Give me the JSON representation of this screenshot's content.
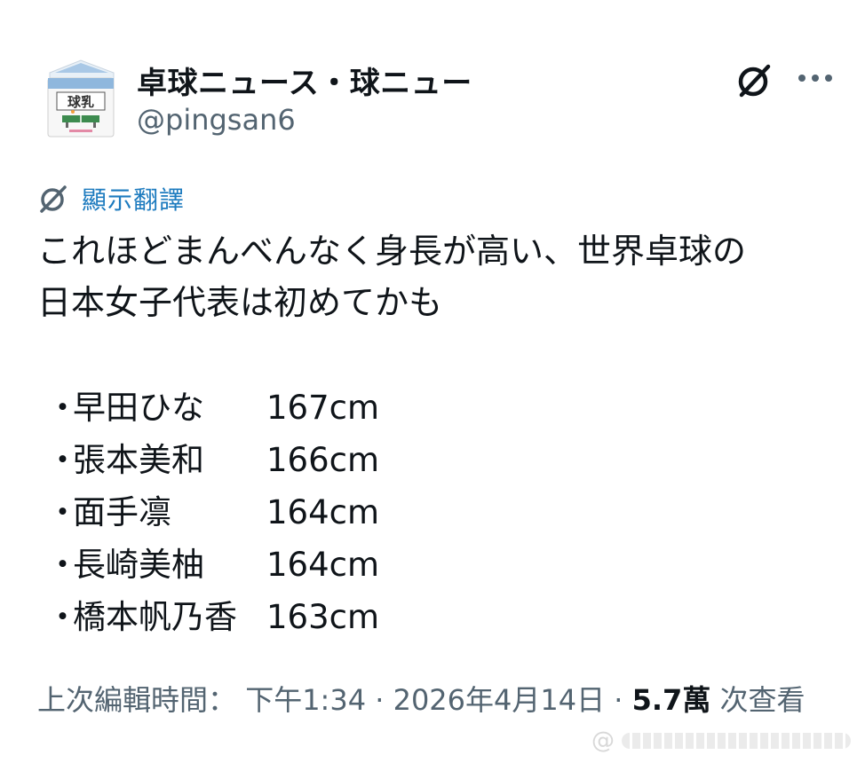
{
  "author": {
    "display_name": "卓球ニュース・球ニュー",
    "handle": "@pingsan6",
    "avatar_icon": "milk-carton-avatar-icon",
    "avatar_text": "球乳"
  },
  "toolbar": {
    "grok_icon": "grok-icon",
    "more_icon": "more-horizontal-icon"
  },
  "translate": {
    "icon": "grok-translate-icon",
    "label": "顯示翻譯"
  },
  "post": {
    "lines": [
      "これほどまんべんなく身長が高い、世界卓球の",
      "日本女子代表は初めてかも"
    ],
    "list": [
      {
        "bullet": "・",
        "name": "早田ひな",
        "height": "167cm"
      },
      {
        "bullet": "・",
        "name": "張本美和",
        "height": "166cm"
      },
      {
        "bullet": "・",
        "name": "面手凛",
        "height": "164cm"
      },
      {
        "bullet": "・",
        "name": "長崎美柚",
        "height": "164cm"
      },
      {
        "bullet": "・",
        "name": "橋本帆乃香",
        "height": "163cm"
      }
    ]
  },
  "meta": {
    "edited_label": "上次編輯時間：",
    "time": "下午1:34",
    "separator": " · ",
    "date": "2026年4月14日",
    "views_number": "5.7萬",
    "views_label": "次查看"
  },
  "colors": {
    "text": "#0f1419",
    "secondary": "#536471",
    "link": "#1d7bbf"
  }
}
